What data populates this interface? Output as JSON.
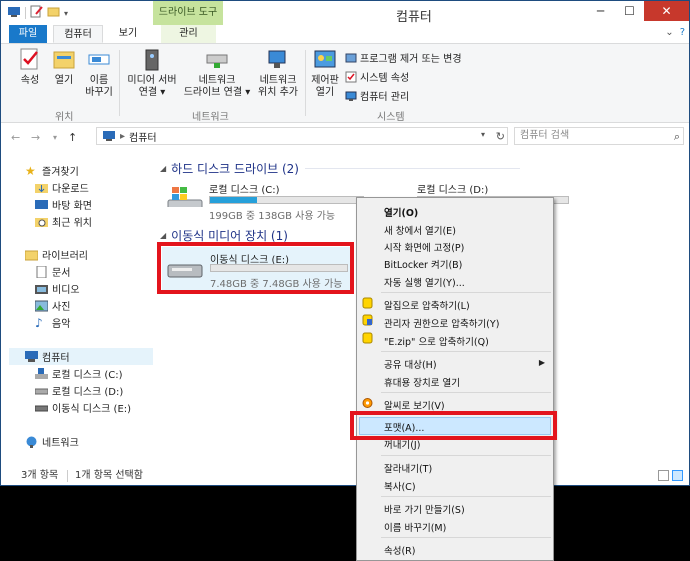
{
  "title": "컴퓨터",
  "context_tab_group": "드라이브 도구",
  "tabs": {
    "file": "파일",
    "computer": "컴퓨터",
    "view": "보기",
    "manage": "관리"
  },
  "ribbon": {
    "location": {
      "properties": "속성",
      "open": "열기",
      "rename_1": "이름",
      "rename_2": "바꾸기",
      "label": "위치"
    },
    "network": {
      "media_1": "미디어 서버",
      "media_2": "연결",
      "map_1": "네트워크",
      "map_2": "드라이브 연결",
      "add_1": "네트워크",
      "add_2": "위치 추가",
      "label": "네트워크"
    },
    "system": {
      "control_1": "제어판",
      "control_2": "열기",
      "uninstall": "프로그램 제거 또는 변경",
      "sysprops": "시스템 속성",
      "manage": "컴퓨터 관리",
      "label": "시스템"
    }
  },
  "address": {
    "path": "컴퓨터",
    "search_placeholder": "컴퓨터 검색"
  },
  "nav": {
    "favorites": "즐겨찾기",
    "downloads": "다운로드",
    "desktop": "바탕 화면",
    "recent": "최근 위치",
    "libraries": "라이브러리",
    "documents": "문서",
    "videos": "비디오",
    "pictures": "사진",
    "music": "음악",
    "computer": "컴퓨터",
    "drive_c": "로컬 디스크 (C:)",
    "drive_d": "로컬 디스크 (D:)",
    "drive_e": "이동식 디스크 (E:)",
    "network": "네트워크"
  },
  "content": {
    "hdd_group": "하드 디스크 드라이브 (2)",
    "removable_group": "이동식 미디어 장치 (1)",
    "drive_c": {
      "name": "로컬 디스크 (C:)",
      "capacity": "199GB 중 138GB 사용 가능",
      "used_fraction": 0.31
    },
    "drive_d": {
      "name": "로컬 디스크 (D:)",
      "used_fraction": 0.1
    },
    "drive_e": {
      "name": "이동식 디스크 (E:)",
      "capacity": "7.48GB 중 7.48GB 사용 가능",
      "used_fraction": 0.0
    }
  },
  "status": {
    "items": "3개 항목",
    "selected": "1개 항목 선택함"
  },
  "context_menu": {
    "open": "열기(O)",
    "open_new_window": "새 창에서 열기(E)",
    "pin_start": "시작 화면에 고정(P)",
    "bitlocker": "BitLocker 켜기(B)",
    "autoplay": "자동 실행 열기(Y)...",
    "alzip_compress": "알집으로 압축하기(L)",
    "admin_compress": "관리자 권한으로 압축하기(Y)",
    "zip_compress": "\"E.zip\" 으로 압축하기(Q)",
    "share": "공유 대상(H)",
    "portable": "휴대용 장치로 열기",
    "alsee": "알씨로 보기(V)",
    "format": "포맷(A)...",
    "eject": "꺼내기(J)",
    "cut": "잘라내기(T)",
    "copy": "복사(C)",
    "shortcut": "바로 가기 만들기(S)",
    "rename": "이름 바꾸기(M)",
    "properties": "속성(R)"
  },
  "colors": {
    "accent": "#1979ca",
    "highlight_red": "#e3141c",
    "drive_bar": "#26a0da",
    "context_tab": "#c6e39d"
  }
}
